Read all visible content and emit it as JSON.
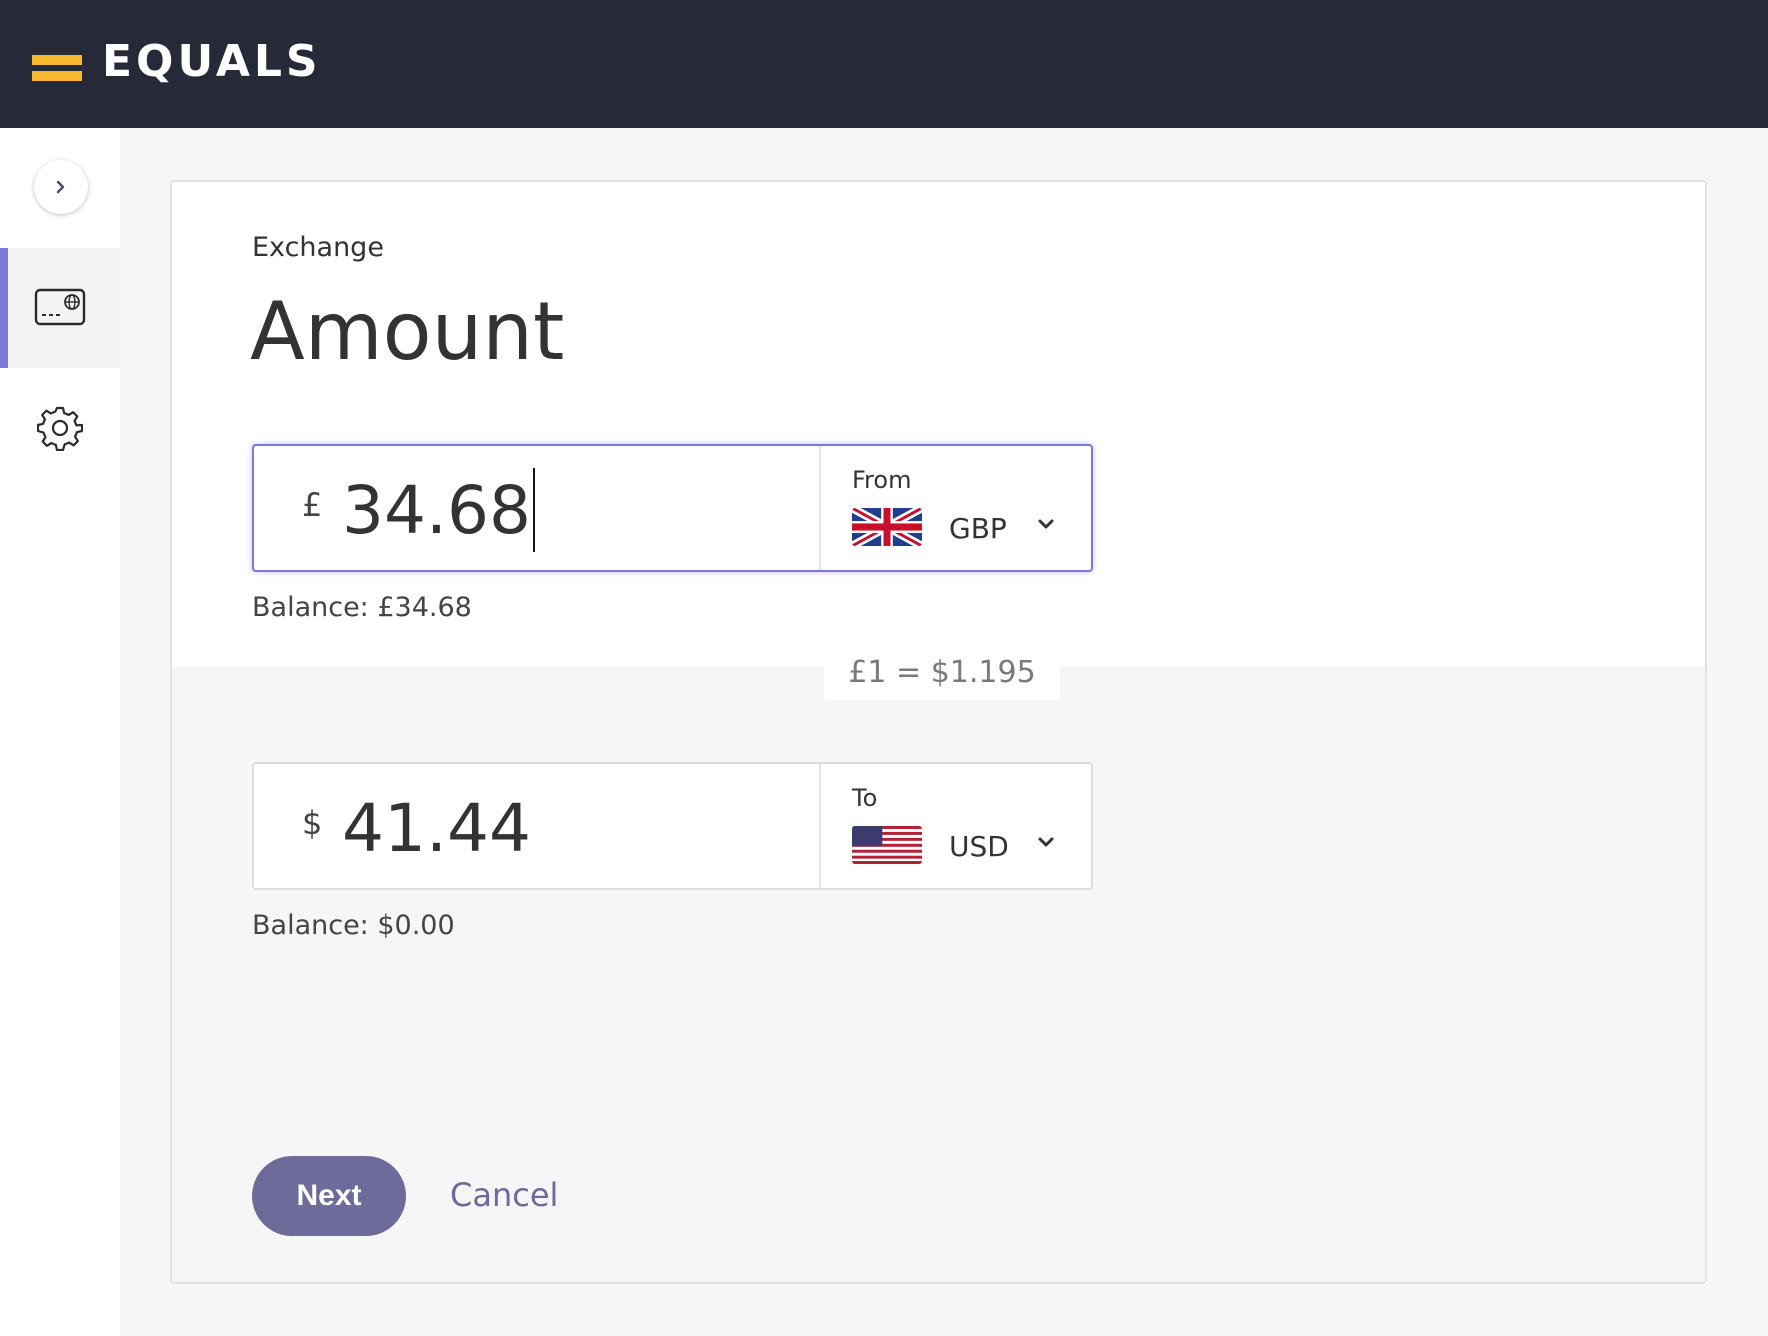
{
  "app": {
    "brand_name": "EQUALS",
    "colors": {
      "topbar": "#262937",
      "brand_accent": "#f5b82e",
      "primary": "#6e6a9a",
      "focus": "#7b77e6"
    }
  },
  "sidebar": {
    "expand_icon": "chevron-right-icon",
    "items": [
      {
        "name": "cards",
        "icon": "card-globe-icon",
        "active": true
      },
      {
        "name": "settings",
        "icon": "gear-icon",
        "active": false
      }
    ]
  },
  "page": {
    "subtitle": "Exchange",
    "title": "Amount"
  },
  "from": {
    "symbol": "£",
    "amount": "34.68",
    "label": "From",
    "currency": "GBP",
    "flag": "uk-flag-icon",
    "balance": "Balance: £34.68"
  },
  "rate": "£1 = $1.195",
  "to": {
    "symbol": "$",
    "amount": "41.44",
    "label": "To",
    "currency": "USD",
    "flag": "us-flag-icon",
    "balance": "Balance: $0.00"
  },
  "actions": {
    "next": "Next",
    "cancel": "Cancel"
  }
}
